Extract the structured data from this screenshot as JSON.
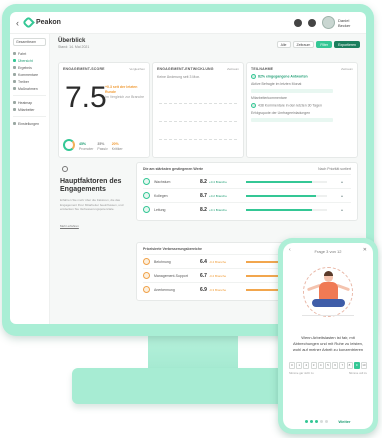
{
  "app": {
    "logo": "Peakon",
    "user_name": "Daniel Becker"
  },
  "sidebar": {
    "team": "Gesamtteam",
    "items": [
      {
        "label": "Fahrt"
      },
      {
        "label": "Übersicht"
      },
      {
        "label": "Ergebnis"
      },
      {
        "label": "Kommentare"
      },
      {
        "label": "Treiber"
      },
      {
        "label": "Maßnahmen"
      }
    ],
    "items2": [
      {
        "label": "Heatmap"
      },
      {
        "label": "Mitarbeiter"
      }
    ],
    "settings": "Einstellungen"
  },
  "header": {
    "title": "Überblick",
    "subtitle": "Stand: 14. Mai 2021",
    "actions": [
      "Alle",
      "Zeitraum",
      "Filter",
      "Exportieren"
    ]
  },
  "score_card": {
    "title": "ENGAGEMENT-SCORE",
    "meta": "Vergleichen",
    "score": "7.5",
    "change": "+0.3 seit der letzten Runde",
    "benchmark": "Im Vergleich zur Branche",
    "participation": "Teilnahme",
    "stat1_label": "Promoter",
    "stat1_value": "45%",
    "stat2_label": "Passiv",
    "stat2_value": "35%",
    "stat3_label": "Kritiker",
    "stat3_value": "20%"
  },
  "dev_card": {
    "title": "ENGAGEMENT-ENTWICKLUNG",
    "meta": "Zeitraum",
    "note": "Keine Änderung seit 3 Mon."
  },
  "info_card": {
    "title": "TEILNAHME",
    "meta": "Zeitraum",
    "line1": "82% eingegangene Antworten",
    "line2": "Aktive Befragte im letzten Monat",
    "line3": "Mitarbeiterkommentare",
    "line4": "438 Kommentare in den letzten 30 Tagen",
    "line5": "Erfolgsquote der Umfrageeinladungen"
  },
  "engagement": {
    "title": "Hauptfaktoren des Engagements",
    "text": "Erfahren Sie mehr über die Faktoren, die das Engagement Ihrer Mitarbeiter beeinflussen, und entdecken Sie Verbesserungspotenziale.",
    "link": "Mehr erfahren"
  },
  "factors_top": {
    "title": "Die am stärksten gestiegenen Werte",
    "more": "Nach Priorität sortiert",
    "rows": [
      {
        "name": "Wachstum",
        "score": "8.2",
        "tag": "+0.4 Branche",
        "fill": 0.82
      },
      {
        "name": "Kollegen",
        "score": "8.7",
        "tag": "+0.2 Branche",
        "fill": 0.87
      },
      {
        "name": "Leitung",
        "score": "8.2",
        "tag": "+0.1 Branche",
        "fill": 0.82
      }
    ]
  },
  "factors_low": {
    "title": "Priorisierte Verbesserungsbereiche",
    "rows": [
      {
        "name": "Belohnung",
        "score": "6.4",
        "tag": "-0.4 Branche",
        "fill": 0.64
      },
      {
        "name": "Management-Support",
        "score": "6.7",
        "tag": "-0.2 Branche",
        "fill": 0.67
      },
      {
        "name": "Anerkennung",
        "score": "6.9",
        "tag": "-0.3 Branche",
        "fill": 0.69
      }
    ]
  },
  "phone": {
    "header": "Frage 3 von 12",
    "close": "✕",
    "back": "‹",
    "question": "Wenn Arbeitslasten ist fair, mit Abbrechungen und mit Ruhe zu leisten, wohl auf meiner Arbeit zu konzentrieren",
    "scale": [
      "0",
      "1",
      "2",
      "3",
      "4",
      "5",
      "6",
      "7",
      "8",
      "9",
      "10"
    ],
    "selected": "9",
    "low_label": "Stimme gar nicht zu",
    "high_label": "Stimme voll zu",
    "next": "Weiter"
  },
  "colors": {
    "accent": "#34c795",
    "accent_dark": "#1b7f5e",
    "warning": "#f09a33",
    "device": "#a9eed5"
  }
}
